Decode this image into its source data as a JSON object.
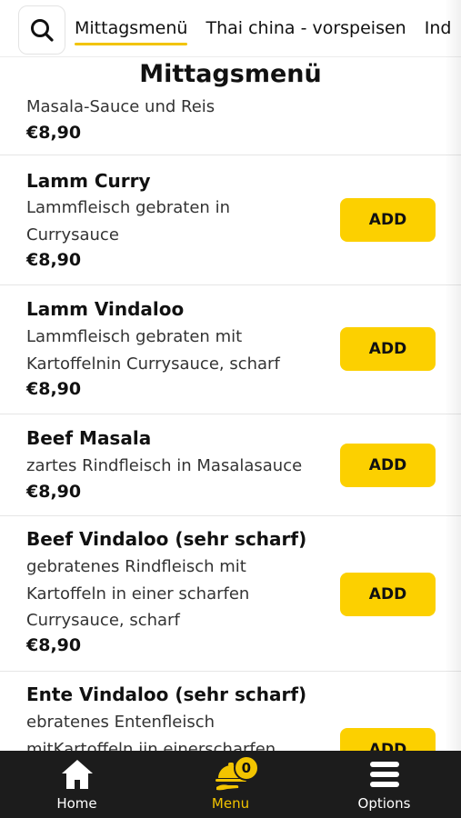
{
  "tabs": [
    "Mittagsmenü",
    "Thai china - vorspeisen",
    "Ind"
  ],
  "section_title": "Mittagsmenü",
  "items": [
    {
      "title": "",
      "desc_lines": [
        "Masala-Sauce und Reis"
      ],
      "price": "€8,90",
      "add_label": ""
    },
    {
      "title": "Lamm Curry",
      "desc_lines": [
        "Lammfleisch gebraten in",
        "Currysauce"
      ],
      "price": "€8,90",
      "add_label": "ADD"
    },
    {
      "title": "Lamm Vindaloo",
      "desc_lines": [
        "Lammfleisch gebraten mit",
        "Kartoffelnin Currysauce, scharf"
      ],
      "price": "€8,90",
      "add_label": "ADD"
    },
    {
      "title": "Beef Masala",
      "desc_lines": [
        "zartes Rindfleisch in Masalasauce"
      ],
      "price": "€8,90",
      "add_label": "ADD"
    },
    {
      "title": "Beef Vindaloo (sehr scharf)",
      "desc_lines": [
        "gebratenes Rindfleisch mit",
        "Kartoffeln in einer scharfen",
        "Currysauce, scharf"
      ],
      "price": "€8,90",
      "add_label": "ADD"
    },
    {
      "title": "Ente Vindaloo (sehr scharf)",
      "desc_lines": [
        "ebratenes Entenfleisch",
        "mitKartoffeln iin einerscharfen"
      ],
      "price": "",
      "add_label": "ADD"
    }
  ],
  "nav": {
    "home": "Home",
    "menu": "Menu",
    "options": "Options",
    "cart_count": "0"
  },
  "colors": {
    "accent": "#fcd000",
    "nav_bg": "#1c1c1c"
  }
}
